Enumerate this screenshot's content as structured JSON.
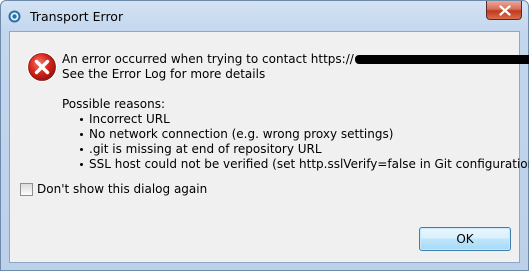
{
  "window": {
    "title": "Transport Error",
    "close_label": "Close"
  },
  "dialog": {
    "message_line1_prefix": "An error occurred when trying to contact https://",
    "message_line1_suffix": ".",
    "message_line2": "See the Error Log for more details",
    "reasons_heading": "Possible reasons:",
    "reasons": [
      "Incorrect URL",
      "No network connection (e.g. wrong proxy settings)",
      ".git is missing at end of repository URL",
      "SSL host could not be verified (set http.sslVerify=false in Git configuration)"
    ],
    "checkbox_label": "Don't show this dialog again",
    "checkbox_checked": false,
    "ok_label": "OK"
  },
  "colors": {
    "error_red": "#d9261c",
    "titlebar": "#c2d6ee",
    "dialog_bg": "#f0f0f0",
    "close_button": "#c23a1c"
  }
}
